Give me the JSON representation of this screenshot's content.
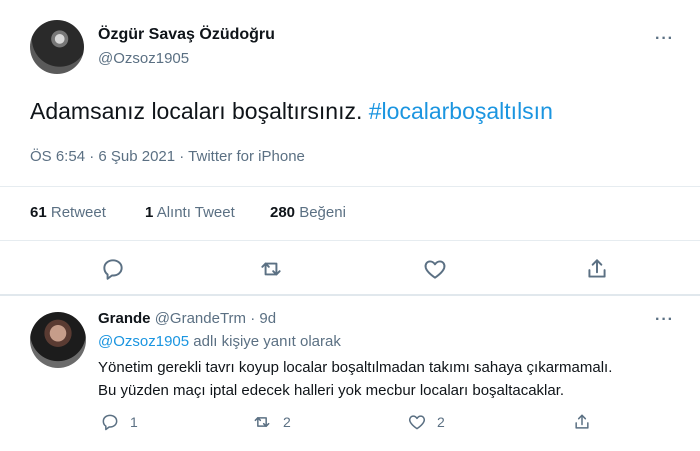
{
  "tweet": {
    "author_name": "Özgür Savaş Özüdoğru",
    "author_handle": "@Ozsoz1905",
    "text_plain": "Adamsanız locaları boşaltırsınız.",
    "hashtag": "#localarboşaltılsın",
    "meta": "ÖS 6:54 · 6 Şub 2021 · Twitter for iPhone",
    "retweet_count": "61",
    "retweet_label": "Retweet",
    "quote_count": "1",
    "quote_label": "Alıntı Tweet",
    "like_count": "280",
    "like_label": "Beğeni"
  },
  "reply": {
    "author_name": "Grande",
    "author_handle": "@GrandeTrm",
    "time": "· 9d",
    "replying_to_handle": "@Ozsoz1905",
    "replying_to_suffix": "adlı kişiye yanıt olarak",
    "line1": "Yönetim gerekli tavrı koyup localar boşaltılmadan takımı sahaya çıkarmamalı.",
    "line2": "Bu yüzden maçı iptal edecek halleri yok mecbur locaları boşaltacaklar.",
    "reply_count": "1",
    "retweet_count": "2",
    "like_count": "2"
  },
  "more_glyph": "···",
  "colors": {
    "accent": "#1b95e0",
    "muted": "#5b7083",
    "text": "#0f1419",
    "border": "#e6ecf0"
  },
  "icons": [
    "reply-icon",
    "retweet-icon",
    "like-icon",
    "share-icon",
    "more-icon"
  ]
}
